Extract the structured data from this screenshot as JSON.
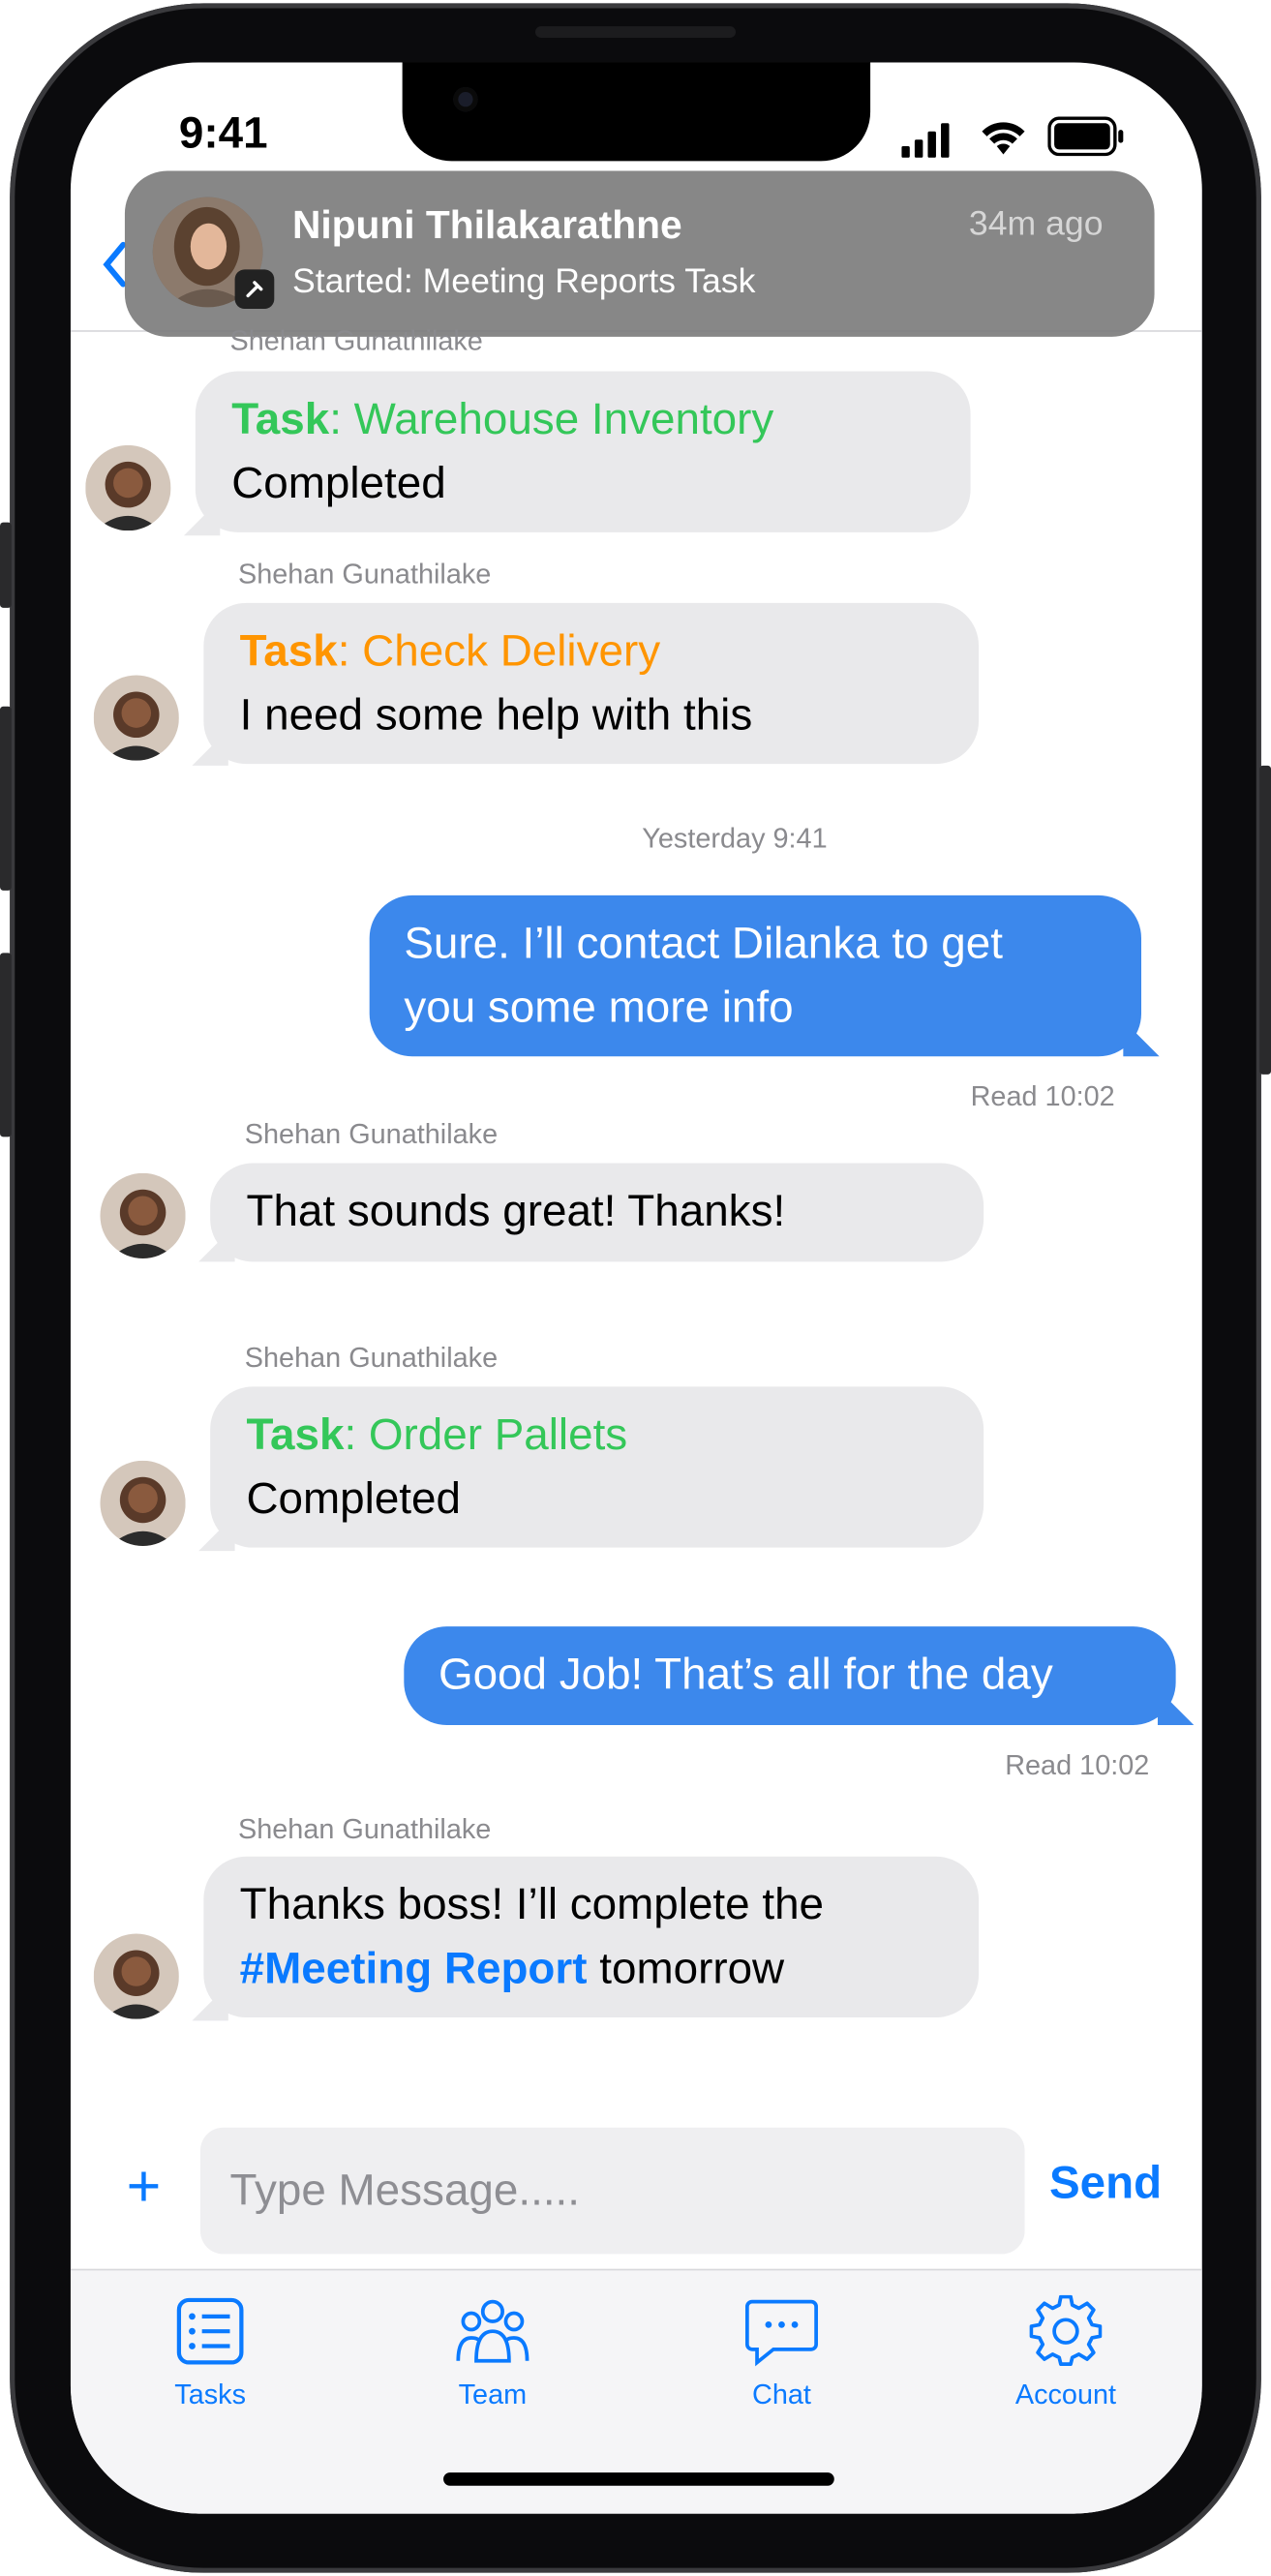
{
  "status_bar": {
    "time": "9:41"
  },
  "notification": {
    "name": "Nipuni Thilakarathne",
    "message": "Started: Meeting Reports Task",
    "time": "34m ago"
  },
  "chat": {
    "partial_sender": "Shehan Gunathilake",
    "messages": [
      {
        "task_label": "Task",
        "task_name": ": Warehouse Inventory",
        "text": "Completed"
      },
      {
        "sender": "Shehan Gunathilake",
        "task_label": "Task",
        "task_name": ": Check Delivery",
        "text": "I need some help with this"
      },
      {
        "timestamp": "Yesterday 9:41"
      },
      {
        "line1": "Sure. I’ll contact Dilanka to get",
        "line2": "you some more info",
        "status": "Read 10:02"
      },
      {
        "sender": "Shehan Gunathilake",
        "text": "That sounds great! Thanks!"
      },
      {
        "sender": "Shehan Gunathilake",
        "task_label": "Task",
        "task_name": ": Order Pallets",
        "text": "Completed"
      },
      {
        "text": "Good Job! That’s all for the day",
        "status": "Read 10:02"
      },
      {
        "sender": "Shehan Gunathilake",
        "line1": "Thanks boss! I’ll complete the",
        "hashtag": "#Meeting Report",
        "line2_rest": " tomorrow"
      }
    ]
  },
  "composer": {
    "plus": "+",
    "placeholder": "Type Message.....",
    "send_label": "Send"
  },
  "tabs": [
    {
      "label": "Tasks",
      "icon": "list-icon"
    },
    {
      "label": "Team",
      "icon": "team-icon"
    },
    {
      "label": "Chat",
      "icon": "chat-bubble-icon"
    },
    {
      "label": "Account",
      "icon": "gear-icon"
    }
  ],
  "colors": {
    "accent": "#0a7aff",
    "outgoing_bubble": "#3c88ec",
    "incoming_bubble": "#e9e9eb",
    "task_completed": "#34c759",
    "task_pending": "#ff9500"
  }
}
